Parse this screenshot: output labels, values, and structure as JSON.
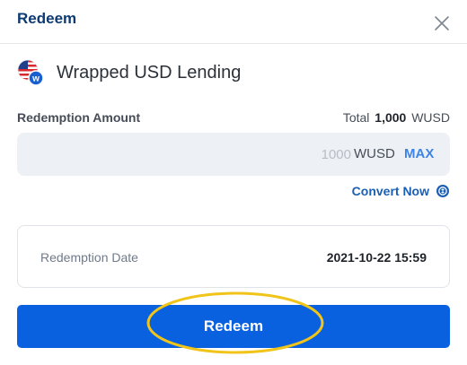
{
  "dialog": {
    "title": "Redeem",
    "close_icon": "close-icon"
  },
  "product": {
    "name": "Wrapped USD Lending",
    "logo_icon": "wusd-flag-logo-icon",
    "logo_badge": "w"
  },
  "amount": {
    "label": "Redemption Amount",
    "total_prefix": "Total",
    "total_value": "1,000",
    "total_unit": "WUSD",
    "placeholder": "1000",
    "unit": "WUSD",
    "max_label": "MAX"
  },
  "convert": {
    "label": "Convert Now",
    "icon": "convert-icon"
  },
  "redemption_date": {
    "label": "Redemption Date",
    "value": "2021-10-22 15:59"
  },
  "action": {
    "redeem_label": "Redeem"
  },
  "colors": {
    "brand_dark": "#0d3a73",
    "button": "#0a61e0",
    "link": "#1a5fb4",
    "max": "#3d84e6",
    "input_bg": "#edf1f6",
    "highlight": "#f0c419"
  }
}
